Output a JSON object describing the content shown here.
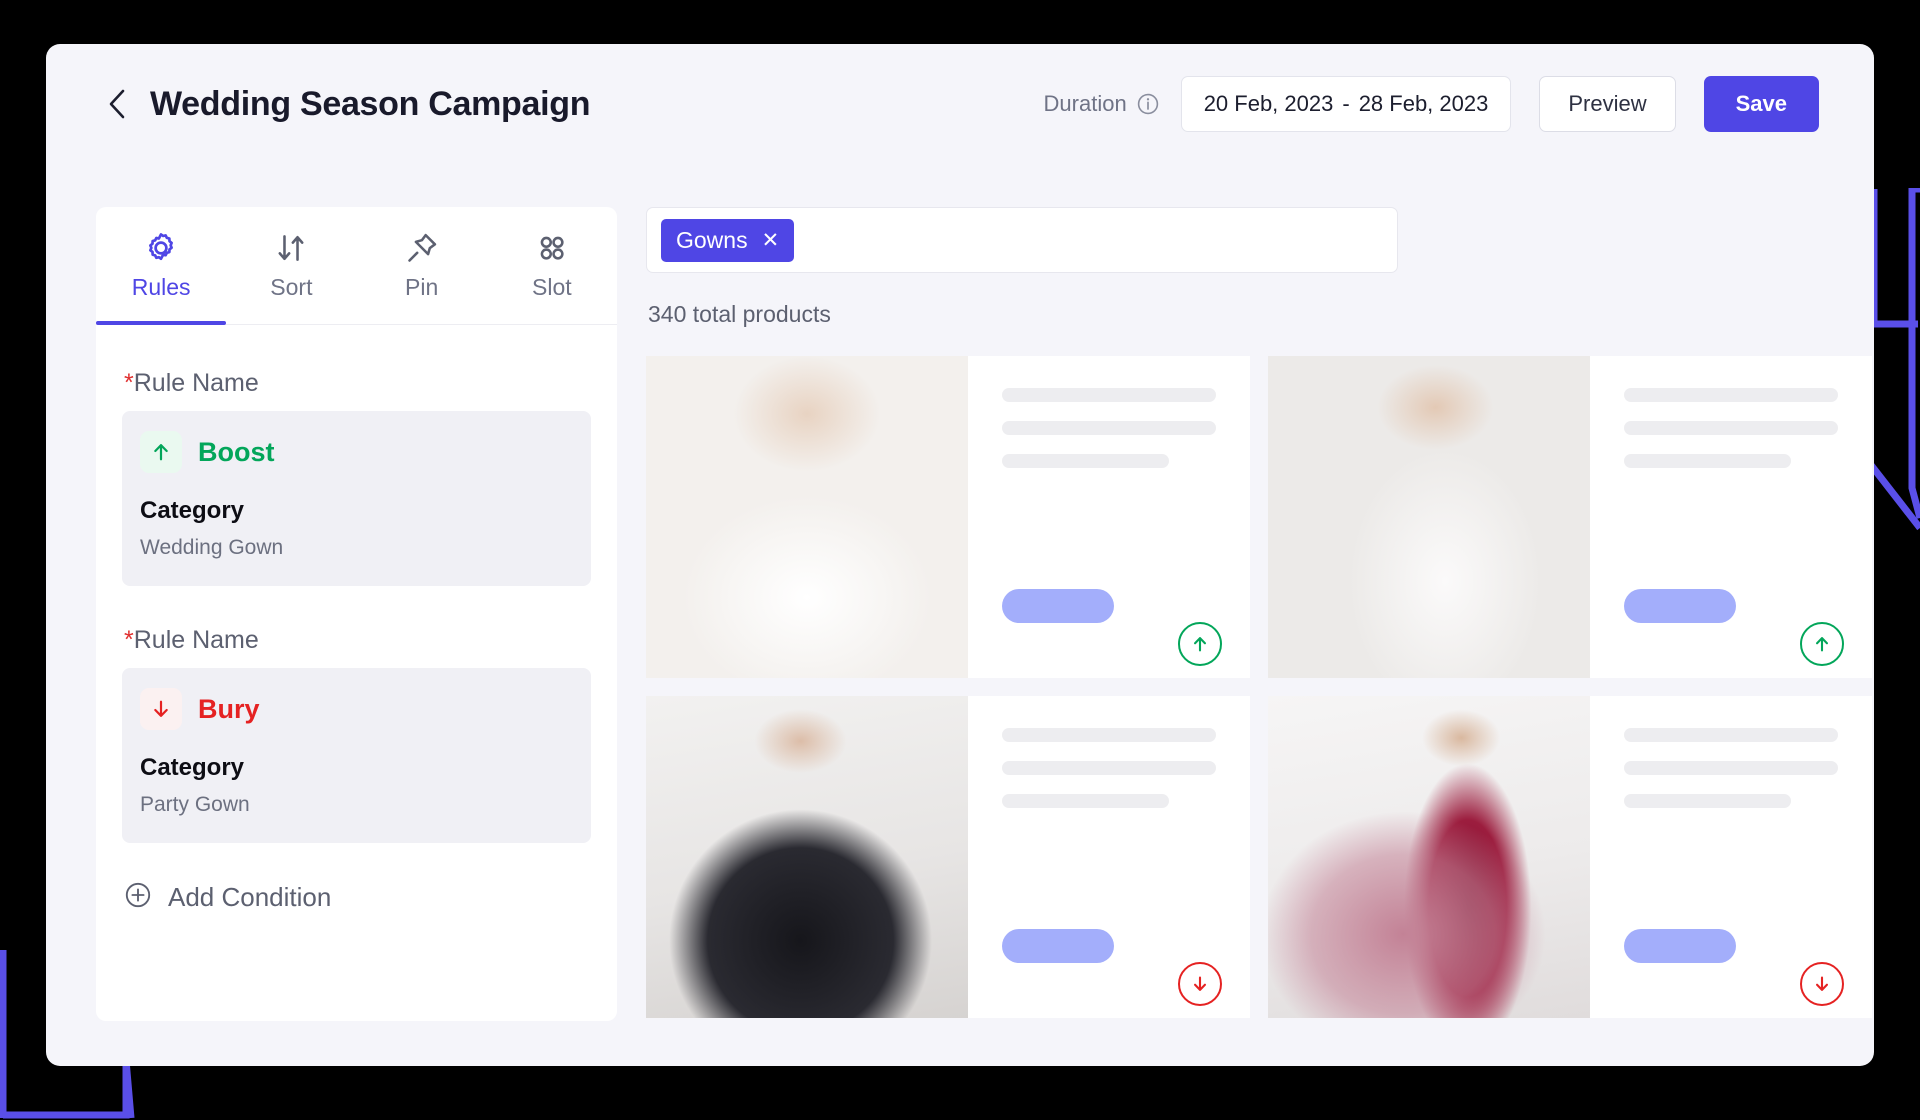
{
  "header": {
    "back_icon": "chevron-left-icon",
    "title": "Wedding Season Campaign",
    "duration_label": "Duration",
    "info_icon": "info-icon",
    "date_start": "20 Feb, 2023",
    "date_separator": "-",
    "date_end": "28 Feb, 2023",
    "preview_label": "Preview",
    "save_label": "Save"
  },
  "sidebar": {
    "tabs": [
      {
        "label": "Rules",
        "icon": "gear-icon",
        "active": true
      },
      {
        "label": "Sort",
        "icon": "sort-arrows-icon",
        "active": false
      },
      {
        "label": "Pin",
        "icon": "pin-icon",
        "active": false
      },
      {
        "label": "Slot",
        "icon": "grid-dots-icon",
        "active": false
      }
    ],
    "rules": [
      {
        "name_label": "Rule Name",
        "required_mark": "*",
        "action": "Boost",
        "action_icon": "arrow-up-icon",
        "field_label": "Category",
        "field_value": "Wedding Gown"
      },
      {
        "name_label": "Rule Name",
        "required_mark": "*",
        "action": "Bury",
        "action_icon": "arrow-down-icon",
        "field_label": "Category",
        "field_value": "Party Gown"
      }
    ],
    "add_condition": {
      "label": "Add Condition",
      "icon": "plus-circle-icon"
    }
  },
  "content": {
    "search_tags": [
      {
        "label": "Gowns",
        "remove_icon": "close-icon"
      }
    ],
    "total_products": "340 total products",
    "products": [
      {
        "image": "wedding-gown-white-ballgown",
        "ranking": "boost",
        "ranking_icon": "arrow-up-circle-icon"
      },
      {
        "image": "wedding-gown-lace-trumpet",
        "ranking": "boost",
        "ranking_icon": "arrow-up-circle-icon"
      },
      {
        "image": "party-gown-black-ruffled",
        "ranking": "bury",
        "ranking_icon": "arrow-down-circle-icon"
      },
      {
        "image": "party-gown-burgundy-floral",
        "ranking": "bury",
        "ranking_icon": "arrow-down-circle-icon"
      }
    ]
  },
  "colors": {
    "accent": "#4F46E5",
    "boost": "#03A65A",
    "bury": "#E52222",
    "pill": "#A3AEFB",
    "app_bg": "#F5F5FA",
    "skeleton": "#EDEDF0",
    "decoration": "#5A4FE8"
  }
}
